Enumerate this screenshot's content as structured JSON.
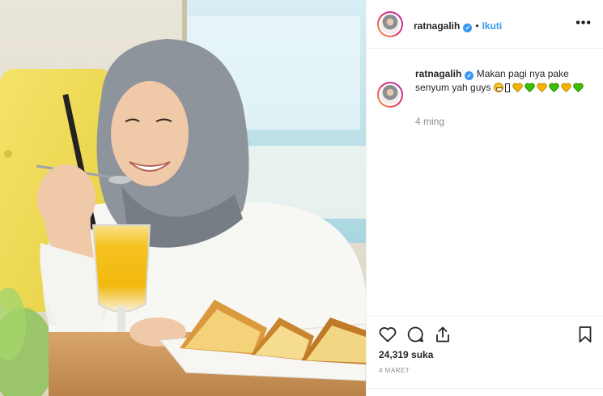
{
  "post": {
    "username": "ratnagalih",
    "verified": true,
    "separator": "•",
    "follow_label": "Ikuti",
    "more_icon": "more-options-icon"
  },
  "caption": {
    "username": "ratnagalih",
    "text": "Makan pagi nya pake senyum yah guys",
    "emojis": [
      "grinning-face",
      "missing-glyph",
      "yellow-heart",
      "green-heart",
      "yellow-heart",
      "green-heart",
      "yellow-heart",
      "green-heart"
    ],
    "time_ago": "4 ming"
  },
  "actions": {
    "like_icon": "heart-icon",
    "comment_icon": "comment-icon",
    "share_icon": "share-icon",
    "save_icon": "bookmark-icon",
    "likes_text": "24,319 suka",
    "date_text": "4 MARET"
  },
  "colors": {
    "link_blue": "#3897f0",
    "text": "#262626",
    "muted": "#8e8e8e",
    "border": "#efefef",
    "yellow_heart": "#f4b400",
    "green_heart": "#3ac000"
  }
}
